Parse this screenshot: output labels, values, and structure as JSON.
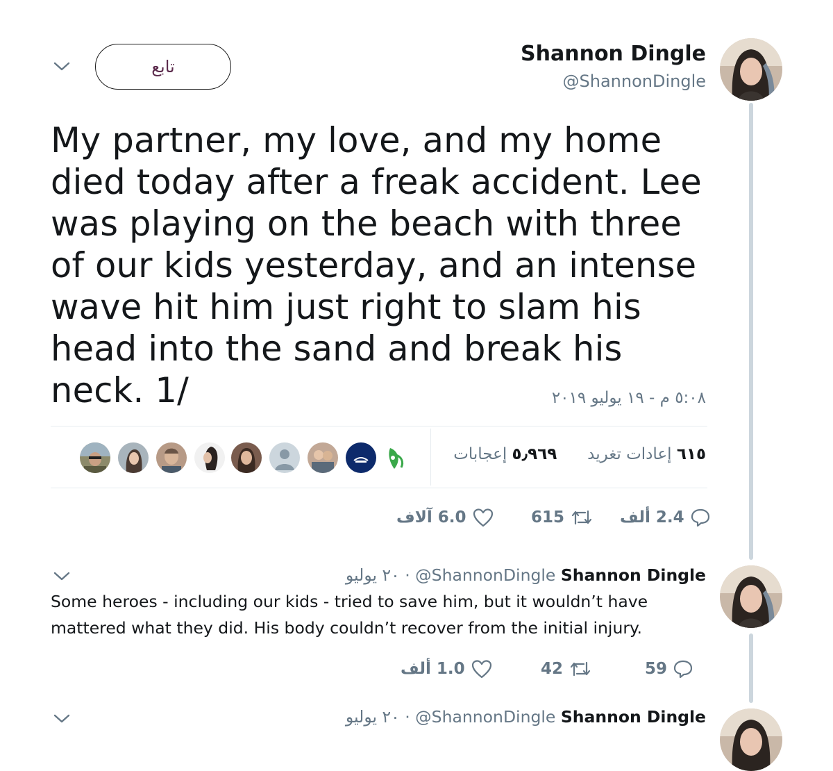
{
  "main_tweet": {
    "author_name": "Shannon Dingle",
    "author_handle": "@ShannonDingle",
    "follow_label": "تابع",
    "text": "My partner, my love, and my home died today after a freak accident. Lee was playing on the beach with three of our kids yesterday, and an intense wave hit him just right to slam his head into the sand and break his neck. 1/",
    "timestamp": "٥:٠٨ م - ١٩ يوليو ٢٠١٩",
    "retweets_count": "٦١٥",
    "retweets_label": "إعادات تغريد",
    "likes_count": "٥٫٩٦٩",
    "likes_label": "إعجابات",
    "actions": {
      "replies": "2.4 ألف",
      "retweets": "615",
      "likes": "6.0 آلاف"
    }
  },
  "likers": [
    {
      "icon": "leaf-logo-avatar",
      "color": "#3aa84a"
    },
    {
      "icon": "dark-blue-logo-avatar",
      "color": "#0d2a6b"
    },
    {
      "icon": "couple-photo-avatar",
      "color": "#8a6a5a"
    },
    {
      "icon": "default-user-avatar",
      "color": "#b8c4cf"
    },
    {
      "icon": "woman-photo-avatar",
      "color": "#6b4b3e"
    },
    {
      "icon": "woman-profile-avatar",
      "color": "#5a4a44"
    },
    {
      "icon": "man-photo-avatar",
      "color": "#9a7a6a"
    },
    {
      "icon": "woman-beach-avatar",
      "color": "#7d6a66"
    },
    {
      "icon": "man-outdoor-avatar",
      "color": "#6f6a55"
    }
  ],
  "reply_1": {
    "author_name": "Shannon Dingle",
    "author_handle": "@ShannonDingle",
    "date": "٢٠ يوليو",
    "separator": "·",
    "text_line1": "Some heroes - including our kids - tried to save him, but it wouldn’t have",
    "text_line2": "mattered what they did. His body couldn’t recover from the initial injury.",
    "actions": {
      "replies": "59",
      "retweets": "42",
      "likes": "1.0 ألف"
    }
  },
  "reply_2": {
    "author_name": "Shannon Dingle",
    "author_handle": "@ShannonDingle",
    "date": "٢٠ يوليو",
    "separator": "·"
  },
  "colors": {
    "text": "#14171a",
    "secondary": "#657786",
    "divider": "#e6ecf0",
    "thread_line": "#ccd6dd"
  }
}
